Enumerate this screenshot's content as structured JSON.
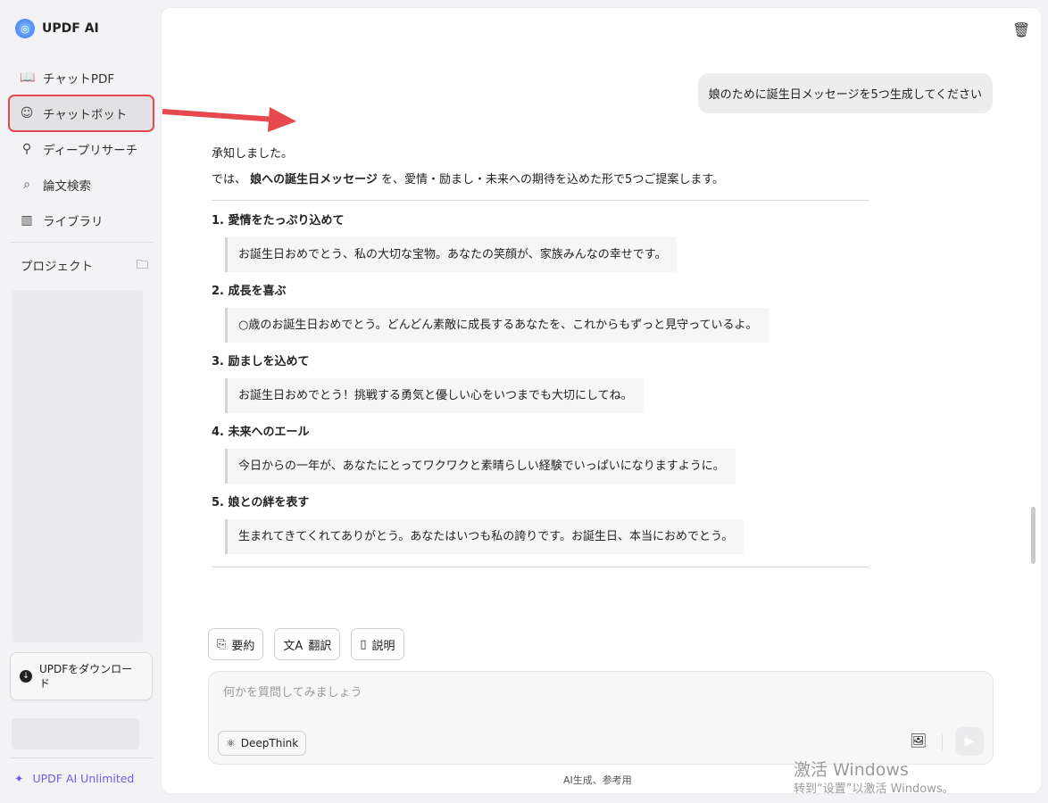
{
  "app": {
    "name": "UPDF AI"
  },
  "sidebar": {
    "items": [
      {
        "label": "チャットPDF",
        "icon": "book-sparkle-icon"
      },
      {
        "label": "チャットボット",
        "icon": "bot-face-icon",
        "active": true
      },
      {
        "label": "ディープリサーチ",
        "icon": "telescope-icon"
      },
      {
        "label": "論文検索",
        "icon": "search-doc-icon"
      },
      {
        "label": "ライブラリ",
        "icon": "library-icon"
      }
    ],
    "project_label": "プロジェクト",
    "download_label": "UPDFをダウンロード",
    "unlimited_label": "UPDF AI Unlimited"
  },
  "chat": {
    "user_message": "娘のために誕生日メッセージを5つ生成してください",
    "intro1": "承知しました。",
    "intro2_pre": "では、",
    "intro2_bold": "娘への誕生日メッセージ",
    "intro2_post": "を、愛情・励まし・未来への期待を込めた形で5つご提案します。",
    "items": [
      {
        "title": "1. 愛情をたっぷり込めて",
        "quote": "お誕生日おめでとう、私の大切な宝物。あなたの笑顔が、家族みんなの幸せです。"
      },
      {
        "title": "2. 成長を喜ぶ",
        "quote": "○歳のお誕生日おめでとう。どんどん素敵に成長するあなたを、これからもずっと見守っているよ。"
      },
      {
        "title": "3. 励ましを込めて",
        "quote": "お誕生日おめでとう！挑戦する勇気と優しい心をいつまでも大切にしてね。"
      },
      {
        "title": "4. 未来へのエール",
        "quote": "今日からの一年が、あなたにとってワクワクと素晴らしい経験でいっぱいになりますように。"
      },
      {
        "title": "5. 娘との絆を表す",
        "quote": "生まれてきてくれてありがとう。あなたはいつも私の誇りです。お誕生日、本当におめでとう。"
      }
    ]
  },
  "tools": [
    {
      "label": "要約"
    },
    {
      "label": "翻訳"
    },
    {
      "label": "説明"
    }
  ],
  "input": {
    "placeholder": "何かを質問してみましょう",
    "deepthink_label": "DeepThink"
  },
  "footnote": "AI生成、参考用",
  "watermark": {
    "line1": "激活 Windows",
    "line2": "转到“设置”以激活 Windows。"
  },
  "colors": {
    "highlight": "#e5484d",
    "accent": "#6c5ce7"
  }
}
